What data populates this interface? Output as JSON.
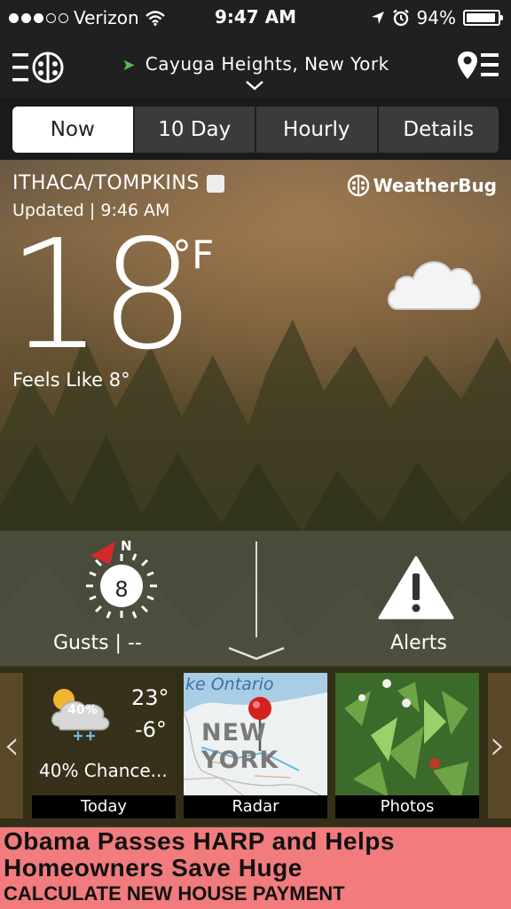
{
  "status_bar": {
    "carrier": "Verizon",
    "time": "9:47 AM",
    "battery": "94%",
    "battery_level": 0.94,
    "signal_dots_filled": 3,
    "signal_dots_total": 5
  },
  "header": {
    "location": "Cayuga Heights, New York"
  },
  "tabs": [
    {
      "label": "Now",
      "active": true
    },
    {
      "label": "10 Day",
      "active": false
    },
    {
      "label": "Hourly",
      "active": false
    },
    {
      "label": "Details",
      "active": false
    }
  ],
  "current": {
    "station": "ITHACA/TOMPKINS",
    "updated": "Updated  |  9:46  AM",
    "brand": "WeatherBug",
    "temperature": "18",
    "unit": "°F",
    "feels_like": "Feels  Like  8°"
  },
  "wind": {
    "direction": "N",
    "speed": "8",
    "gusts_label": "Gusts  |  --"
  },
  "alerts": {
    "label": "Alerts"
  },
  "cards": {
    "today": {
      "high": "23°",
      "low": "-6°",
      "chance_badge": "40%",
      "chance_text": "40%  Chance...",
      "label": "Today"
    },
    "radar": {
      "water_label": "ke Ontario",
      "region_label": "NEW YORK",
      "label": "Radar"
    },
    "photos": {
      "label": "Photos"
    }
  },
  "ad": {
    "line1": "Obama Passes HARP and Helps",
    "line2": "Homeowners Save Huge",
    "line3": "CALCULATE NEW HOUSE PAYMENT"
  },
  "colors": {
    "header_bg": "#202020",
    "tab_active_bg": "#ffffff",
    "tab_bg": "#3b3b3b",
    "location_arrow": "#5bb95b",
    "compass_needle": "#d22a2a",
    "radar_pin": "#d62020",
    "ad_bg": "#f27b7d"
  }
}
